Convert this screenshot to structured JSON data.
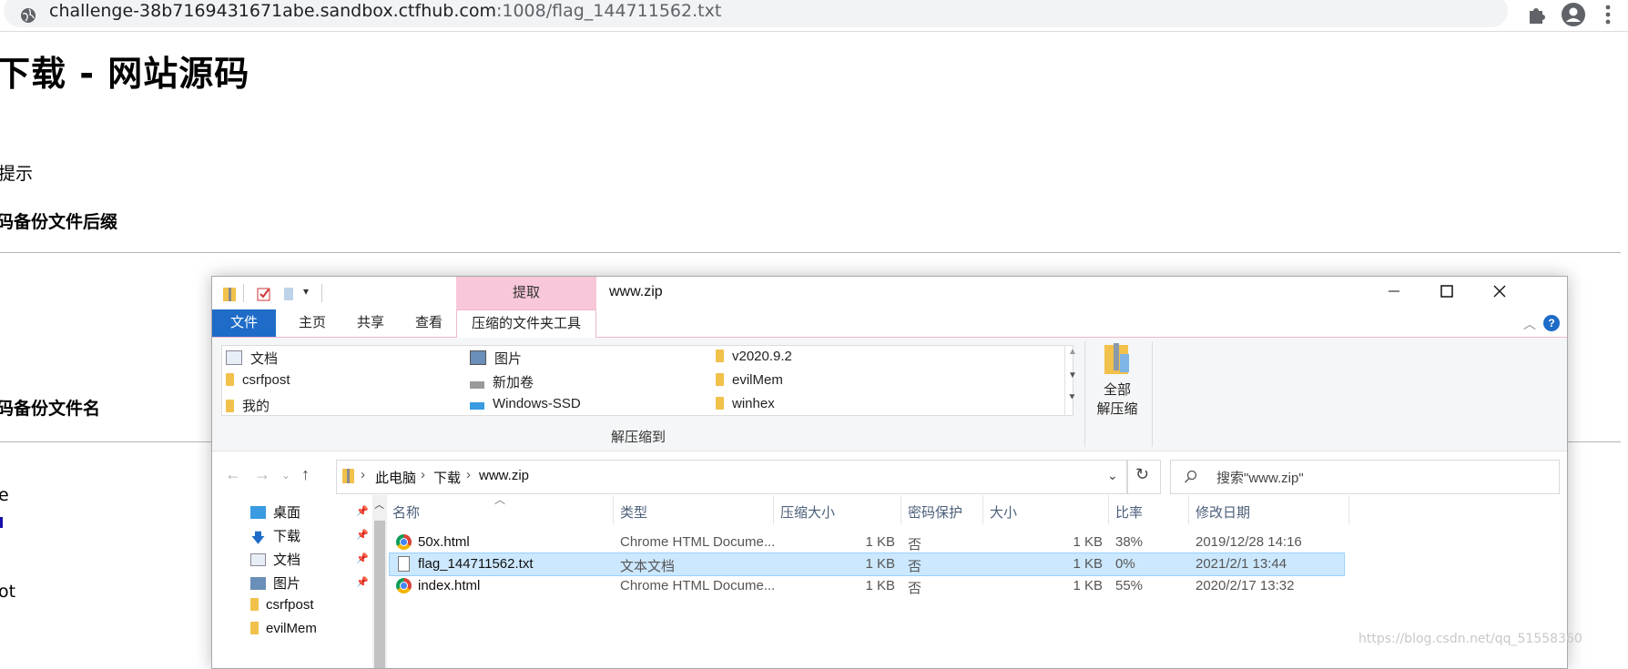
{
  "browser": {
    "url_host": "challenge-38b7169431671abe.sandbox.ctfhub.com",
    "url_path": ":1008/flag_144711562.txt"
  },
  "page": {
    "title": "件下载 - 网站源码",
    "hint": "提示",
    "heading1": "码备份文件后缀",
    "heading2": "码备份文件名",
    "frag_e": "e",
    "frag_ot": "ot"
  },
  "explorer": {
    "context_tab": "提取",
    "window_title": "www.zip",
    "tabs": {
      "file": "文件",
      "home": "主页",
      "share": "共享",
      "view": "查看",
      "tools": "压缩的文件夹工具"
    },
    "destinations": [
      [
        "文档",
        "图片",
        "v2020.9.2"
      ],
      [
        "csrfpost",
        "新加卷",
        "evilMem"
      ],
      [
        "我的",
        "Windows-SSD",
        "winhex"
      ]
    ],
    "extract_to_label": "解压缩到",
    "extract_all_line1": "全部",
    "extract_all_line2": "解压缩",
    "breadcrumb": {
      "pc": "此电脑",
      "downloads": "下载",
      "zip": "www.zip"
    },
    "search_placeholder": "搜索\"www.zip\"",
    "nav_items": [
      "桌面",
      "下载",
      "文档",
      "图片",
      "csrfpost",
      "evilMem"
    ],
    "columns": [
      "名称",
      "类型",
      "压缩大小",
      "密码保护",
      "大小",
      "比率",
      "修改日期"
    ],
    "files": [
      {
        "name": "50x.html",
        "type": "Chrome HTML Docume...",
        "compressed": "1 KB",
        "protected": "否",
        "size": "1 KB",
        "ratio": "38%",
        "modified": "2019/12/28 14:16"
      },
      {
        "name": "flag_144711562.txt",
        "type": "文本文档",
        "compressed": "1 KB",
        "protected": "否",
        "size": "1 KB",
        "ratio": "0%",
        "modified": "2021/2/1 13:44"
      },
      {
        "name": "index.html",
        "type": "Chrome HTML Docume...",
        "compressed": "1 KB",
        "protected": "否",
        "size": "1 KB",
        "ratio": "55%",
        "modified": "2020/2/17 13:32"
      }
    ]
  },
  "watermark": "https://blog.csdn.net/qq_51558360",
  "colors": {
    "ribbon_file_tab": "#1e6cc7",
    "context_tab": "#f8c7d9",
    "selection": "#cce8ff"
  }
}
